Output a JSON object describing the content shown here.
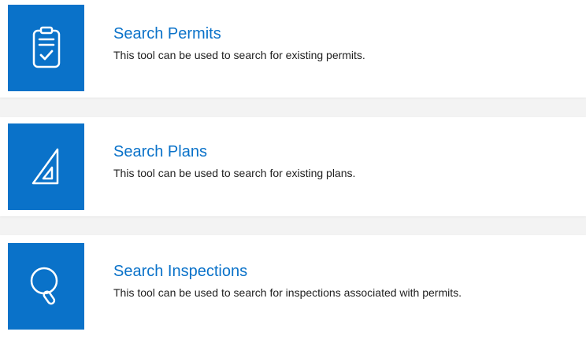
{
  "tools": [
    {
      "title": "Search Permits",
      "description": "This tool can be used to search for existing permits.",
      "icon": "clipboard-check-icon"
    },
    {
      "title": "Search Plans",
      "description": "This tool can be used to search for existing plans.",
      "icon": "triangle-ruler-icon"
    },
    {
      "title": "Search Inspections",
      "description": "This tool can be used to search for inspections associated with permits.",
      "icon": "magnifier-icon"
    }
  ],
  "colors": {
    "accent": "#0a72c9",
    "page_background": "#f3f3f3",
    "card_background": "#ffffff",
    "text": "#1e1e1e"
  }
}
